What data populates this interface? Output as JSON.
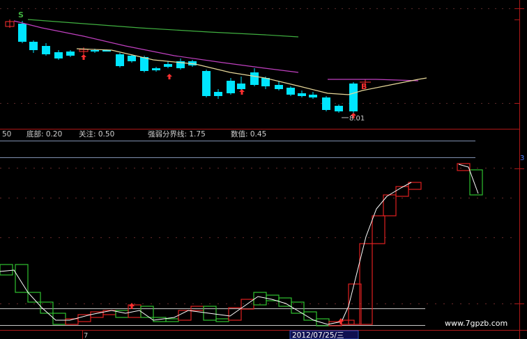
{
  "colors": {
    "background": "#000000",
    "candle_up": "#ff3030",
    "candle_down": "#00e5ff",
    "ma_yellow": "#e8d89a",
    "ma_magenta": "#c040c0",
    "ma_green": "#40b040",
    "indicator_up": "#e02020",
    "indicator_down": "#30c030",
    "indicator_line": "#ffffff",
    "threshold_line": "#d0d0d0",
    "panel_border": "#c02020",
    "label_orange": "#ff8000",
    "label_text": "#c0c0c0",
    "watermark": "#ffffff"
  },
  "main_panel": {
    "sell_marker": "S",
    "buy_marker": "B",
    "low_price_label": "8.01",
    "buy_arrow_icon": "up-arrow-icon"
  },
  "indicator_header": {
    "left_value": "50",
    "bottom_label": "底部: 0.20",
    "watch_label": "关注: 0.50",
    "divider_label": "强弱分界线: 1.75",
    "value_label": "数值: 0.45"
  },
  "right_axis": {
    "tick_label": "3"
  },
  "time_axis": {
    "month_label": "7",
    "date_label": "2012/07/25/三"
  },
  "watermark": "www.7gpzb.com"
}
